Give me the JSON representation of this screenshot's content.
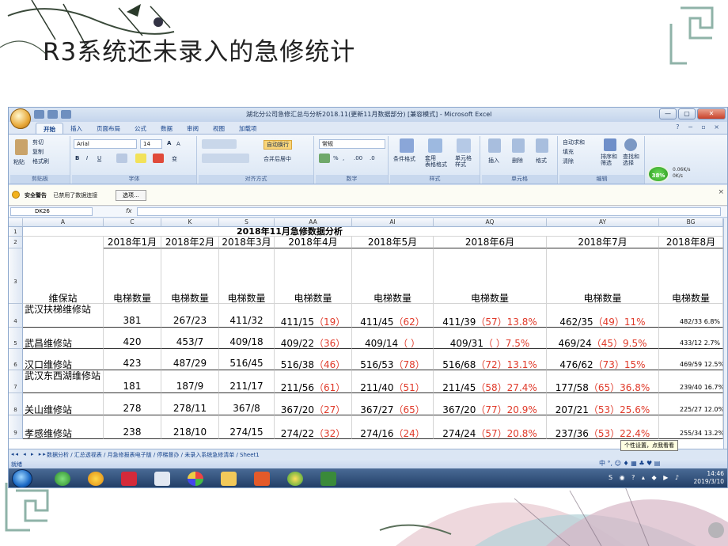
{
  "slide": {
    "title": "R3系统还未录入的急修统计"
  },
  "excel": {
    "window_title": "湖北分公司急修汇总与分析2018.11(更新11月数据部分)  [兼容模式] - Microsoft Excel",
    "window_buttons": {
      "minimize": "—",
      "maximize": "▢",
      "close": "✕"
    },
    "help_icons": "? − ▫ ×",
    "tabs": [
      "开始",
      "插入",
      "页面布局",
      "公式",
      "数据",
      "审阅",
      "视图",
      "加载项"
    ],
    "ribbon": {
      "clipboard": {
        "paste": "粘贴",
        "cut": "剪切",
        "copy": "复制",
        "format_painter": "格式刷",
        "label": "剪贴板"
      },
      "font": {
        "name": "Arial",
        "size": "14",
        "bold": "B",
        "italic": "I",
        "underline": "U",
        "grow": "A",
        "shrink": "A",
        "label": "字体",
        "phonetic": "变"
      },
      "alignment": {
        "wrap": "自动换行",
        "merge": "合并后居中",
        "label": "对齐方式"
      },
      "number": {
        "format": "常规",
        "percent": "%",
        "comma": ",",
        "inc": ".00",
        "dec": ".0",
        "label": "数字"
      },
      "styles": {
        "conditional": "条件格式",
        "table": "套用\n表格格式",
        "cell": "单元格\n样式",
        "label": "样式"
      },
      "cells": {
        "insert": "插入",
        "delete": "删除",
        "format": "格式",
        "label": "单元格"
      },
      "editing": {
        "autosum": "自动求和",
        "fill": "填充",
        "clear": "清除",
        "sort": "排序和\n筛选",
        "find": "查找和\n选择",
        "label": "编辑"
      }
    },
    "network_gauge": {
      "percent": "38%",
      "up": "0.06K/s",
      "down": "0K/s"
    },
    "security": {
      "label": "安全警告",
      "message": "已禁用了数据连接",
      "options": "选项..."
    },
    "name_box": "DK26",
    "fx": "fx",
    "columns": [
      "A",
      "C",
      "K",
      "S",
      "AA",
      "AI",
      "AQ",
      "AY",
      "BG"
    ],
    "row_numbers": [
      "1",
      "2",
      "3",
      "4",
      "5",
      "6",
      "7",
      "8",
      "9"
    ],
    "sheet_title": "2018年11月急修数据分析",
    "months": [
      "2018年1月",
      "2018年2月",
      "2018年3月",
      "2018年4月",
      "2018年5月",
      "2018年6月",
      "2018年7月",
      "2018年8月"
    ],
    "header_station": "维保站",
    "header_count": "电梯数量",
    "rows": [
      {
        "station": "武汉扶梯维修站",
        "c": "381",
        "k": "267/23",
        "s": "411/32",
        "aa_main": "411/15",
        "aa_red": "（19）",
        "ai_main": "411/45",
        "ai_red": "（62）",
        "aq_main": "411/39",
        "aq_red": "（57）13.8%",
        "ay_main": "462/35",
        "ay_red": "（49）11%",
        "bg": "482/33  6.8%"
      },
      {
        "station": "武昌维修站",
        "c": "420",
        "k": "453/7",
        "s": "409/18",
        "aa_main": "409/22",
        "aa_red": "（36）",
        "ai_main": "409/14",
        "ai_red": "（  ）",
        "aq_main": "409/31",
        "aq_red": "（  ）7.5%",
        "ay_main": "469/24",
        "ay_red": "（45）9.5%",
        "bg": "433/12  2.7%"
      },
      {
        "station": "汉口维修站",
        "c": "423",
        "k": "487/29",
        "s": "516/45",
        "aa_main": "516/38",
        "aa_red": "（46）",
        "ai_main": "516/53",
        "ai_red": "（78）",
        "aq_main": "516/68",
        "aq_red": "（72）13.1%",
        "ay_main": "476/62",
        "ay_red": "（73）15%",
        "bg": "469/59  12.5%"
      },
      {
        "station": "武汉东西湖维修站",
        "c": "181",
        "k": "187/9",
        "s": "211/17",
        "aa_main": "211/56",
        "aa_red": "（61）",
        "ai_main": "211/40",
        "ai_red": "（51）",
        "aq_main": "211/45",
        "aq_red": "（58）27.4%",
        "ay_main": "177/58",
        "ay_red": "（65）36.8%",
        "bg": "239/40  16.7%"
      },
      {
        "station": "关山维修站",
        "c": "278",
        "k": "278/11",
        "s": "367/8",
        "aa_main": "367/20",
        "aa_red": "（27）",
        "ai_main": "367/27",
        "ai_red": "（65）",
        "aq_main": "367/20",
        "aq_red": "（77）20.9%",
        "ay_main": "207/21",
        "ay_red": "（53）25.6%",
        "bg": "225/27  12.0%"
      },
      {
        "station": "孝感维修站",
        "c": "238",
        "k": "218/10",
        "s": "274/15",
        "aa_main": "274/22",
        "aa_red": "（32）",
        "ai_main": "274/16",
        "ai_red": "（24）",
        "aq_main": "274/24",
        "aq_red": "（57）20.8%",
        "ay_main": "237/36",
        "ay_red": "（53）22.4%",
        "bg": "255/34  13.2%"
      }
    ],
    "sheet_tabs": "数据分析 / 汇总透视表 / 月急修报表电子版 / 停梯督办 / 未录入系统急修清单 / Sheet1",
    "sheet_nav": "◂◂ ◂ ▸ ▸▸",
    "status_ready": "就绪",
    "tooltip": "个性设置，点我看看",
    "ime_bar": "中 °, ☺ ♦ ▦ ♣ ♥ ▤",
    "clock": {
      "time": "14:46",
      "date": "2019/3/10"
    },
    "tray_icons": "S ◉ ? ▴ ◆ ▶ ♪"
  }
}
